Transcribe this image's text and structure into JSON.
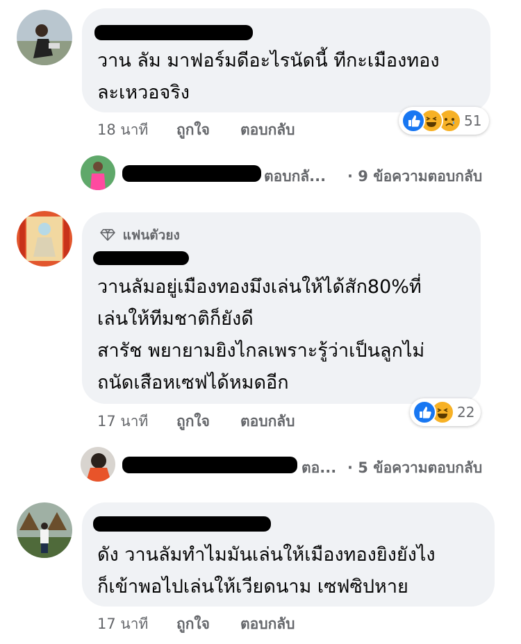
{
  "comments": [
    {
      "text_lines": [
        "วาน ลัม มาฟอร์มดีอะไรนัดนี้ ทีกะเมืองทอง",
        "ละเหวอจริง"
      ],
      "time": "18 นาที",
      "like_label": "ถูกใจ",
      "reply_label": "ตอบกลับ",
      "reactions": [
        "like",
        "haha",
        "sad"
      ],
      "reaction_count": "51",
      "replies": {
        "preview": "ตอบกลั...",
        "count_text": "· 9 ข้อความตอบกลับ"
      }
    },
    {
      "badge": "แฟนตัวยง",
      "text_lines": [
        "วานลัมอยู่เมืองทองมึงเล่นให้ได้สัก80%ที่",
        "เล่นให้ทีมชาติก็ยังดี",
        "สารัช พยายามยิงไกลเพราะรู้ว่าเป็นลูกไม่",
        "ถนัดเสือหเซฟได้หมดอีก"
      ],
      "time": "17 นาที",
      "like_label": "ถูกใจ",
      "reply_label": "ตอบกลับ",
      "reactions": [
        "like",
        "haha"
      ],
      "reaction_count": "22",
      "replies": {
        "preview": "ตอ...",
        "count_text": "· 5 ข้อความตอบกลับ"
      }
    },
    {
      "text_lines": [
        "ดัง วานลัมทำไมมันเล่นให้เมืองทองยิงยังไง",
        "ก็เข้าพอไปเล่นให้เวียดนาม เซฟซิปหาย"
      ],
      "time": "17 นาที",
      "like_label": "ถูกใจ",
      "reply_label": "ตอบกลับ"
    }
  ],
  "colors": {
    "bubble": "#f0f2f5",
    "meta_text": "#65676b",
    "like_blue": "#1877f2",
    "haha_yellow": "#f7b125"
  }
}
